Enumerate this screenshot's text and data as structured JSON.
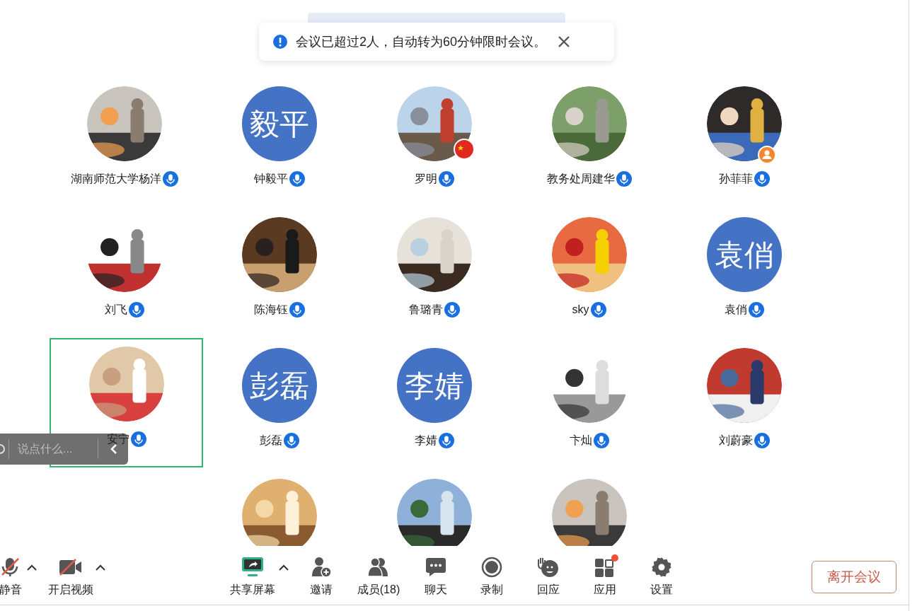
{
  "notification": {
    "message": "会议已超过2人，自动转为60分钟限时会议。"
  },
  "participants": [
    {
      "name": "湖南师范大学杨洋",
      "selected": false
    },
    {
      "name": "钟毅平",
      "avatar": {
        "kind": "text",
        "text": "毅平"
      },
      "selected": false
    },
    {
      "name": "罗明",
      "badge": {
        "kind": "flag"
      },
      "selected": false
    },
    {
      "name": "教务处周建华",
      "selected": false
    },
    {
      "name": "孙菲菲",
      "badge": {
        "kind": "person"
      },
      "selected": false
    },
    {
      "name": "刘飞",
      "selected": false
    },
    {
      "name": "陈海钰",
      "selected": false
    },
    {
      "name": "鲁璐青",
      "selected": false
    },
    {
      "name": "sky",
      "selected": false
    },
    {
      "name": "袁俏",
      "avatar": {
        "kind": "text",
        "text": "袁俏"
      },
      "selected": false
    },
    {
      "name": "安宁",
      "selected": true
    },
    {
      "name": "彭磊",
      "avatar": {
        "kind": "text",
        "text": "彭磊"
      },
      "selected": false
    },
    {
      "name": "李婧",
      "avatar": {
        "kind": "text",
        "text": "李婧"
      },
      "selected": false
    },
    {
      "name": "卞灿",
      "selected": false
    },
    {
      "name": "刘蔚豪",
      "selected": false
    },
    {
      "selected": false
    },
    {
      "selected": false
    },
    {
      "selected": false
    }
  ],
  "chat_bar": {
    "placeholder": "说点什么..."
  },
  "toolbar": [
    {
      "kind": "mic-off",
      "label": "静音",
      "caret": true
    },
    {
      "kind": "video-off",
      "label": "开启视频",
      "caret": true
    },
    {
      "kind": "share",
      "label": "共享屏幕",
      "caret": true
    },
    {
      "kind": "invite",
      "label": "邀请",
      "caret": false
    },
    {
      "kind": "members",
      "label": "成员(18)",
      "caret": false
    },
    {
      "kind": "chat",
      "label": "聊天",
      "caret": false
    },
    {
      "kind": "record",
      "label": "录制",
      "caret": false
    },
    {
      "kind": "react",
      "label": "回应",
      "caret": false
    },
    {
      "kind": "apps",
      "label": "应用",
      "caret": false,
      "badge": true
    },
    {
      "kind": "settings",
      "label": "设置",
      "caret": false
    }
  ],
  "leave_button": "离开会议"
}
